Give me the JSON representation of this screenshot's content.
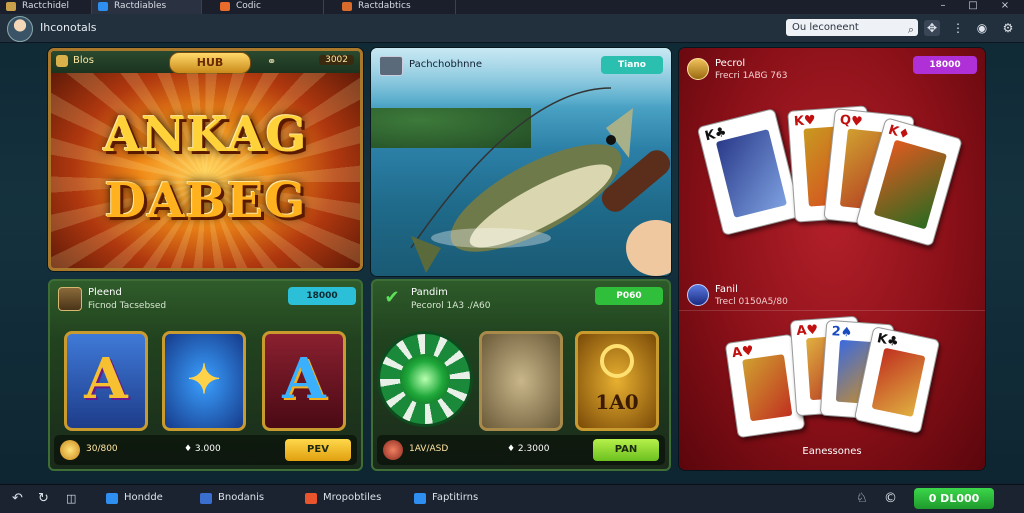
{
  "tabs": [
    {
      "label": "Ractchidel",
      "color": "#c9a14b",
      "active": false
    },
    {
      "label": "Ractdiables",
      "color": "#2e8ff0",
      "active": true
    },
    {
      "label": "Codic",
      "color": "#e86b2c",
      "active": false
    },
    {
      "label": "Ractdabtics",
      "color": "#d86b2c",
      "active": false
    }
  ],
  "window": {
    "minimize": "–",
    "maximize": "□",
    "close": "×"
  },
  "titlebar": {
    "app_title": "Ihconotals",
    "search_value": "Ou leconeent",
    "icons": [
      "search-icon",
      "gamepad-icon",
      "more-icon",
      "record-icon",
      "settings-icon"
    ]
  },
  "slot_hero": {
    "name": "Blos",
    "badge": "HUB",
    "amount": "3002",
    "line1": "ANKAG",
    "line2": "DABEG"
  },
  "fishing": {
    "title": "Pachchobhnne",
    "button": "Tiano"
  },
  "card_games": {
    "top": {
      "title": "Pecrol",
      "subtitle": "Frecri 1ABG 763",
      "button": "18000"
    },
    "bottom": {
      "title": "Fanil",
      "subtitle": "Trecl 0150A5/80"
    },
    "caption": "Eanessones"
  },
  "slot_panel_a": {
    "title": "Pleend",
    "subtitle": "Ficnod Tacsebsed",
    "button": "18000",
    "tiles": [
      "A",
      "✦",
      "A"
    ],
    "footer_value": "30/800",
    "footer_price": "♦ 3.000",
    "footer_action": "PEV"
  },
  "slot_panel_b": {
    "title": "Pandim",
    "subtitle": "Pecorol 1A3 ./A60",
    "button": "P060",
    "tiles": [
      "",
      "",
      "1A0"
    ],
    "footer_value": "1AV/ASD",
    "footer_price": "♦ 2.3000",
    "footer_action": "PAN"
  },
  "taskbar": {
    "items": [
      {
        "label": "Hondde",
        "color": "#2e8ff0"
      },
      {
        "label": "Bnodanis",
        "color": "#3a6fd0"
      },
      {
        "label": "Mropobtiles",
        "color": "#e8552c"
      },
      {
        "label": "Faptitirns",
        "color": "#2e8ff0"
      }
    ],
    "wallet": "0 DL000"
  },
  "colors": {
    "accent_green": "#2fbf3a",
    "accent_purple": "#b030d8",
    "accent_teal": "#2bbfb0",
    "felt_red": "#9a1520"
  }
}
